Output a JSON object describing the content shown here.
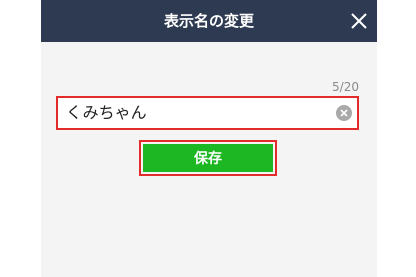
{
  "header": {
    "title": "表示名の変更",
    "close_icon": "close-icon"
  },
  "form": {
    "char_counter": "5/20",
    "display_name_value": "くみちゃん",
    "clear_icon": "clear-circle-x-icon"
  },
  "actions": {
    "save_label": "保存"
  },
  "colors": {
    "header_bg": "#2e3a52",
    "save_button": "#1db724",
    "highlight_border": "#e32b2b",
    "page_bg": "#f4f4f4"
  }
}
